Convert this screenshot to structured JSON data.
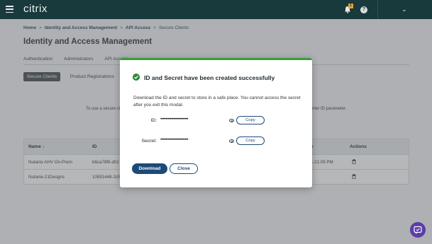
{
  "topbar": {
    "brand": "citrix",
    "notification_count": "1",
    "help_symbol": "?",
    "chevron": "⌄",
    "colors": {
      "background": "#193a3c",
      "badge": "#e8a13a"
    }
  },
  "breadcrumb": [
    "Home",
    "Identity and Access Management",
    "API Access",
    "Secure Clients"
  ],
  "breadcrumb_separator": ">",
  "page_title": "Identity and Access Management",
  "tabs": [
    "Authentication",
    "Administrators",
    "API Access"
  ],
  "subtabs": {
    "active": "Secure Clients",
    "other": "Product Registrations"
  },
  "info": {
    "left": "To use a secure cl",
    "right": "mer ID parameter."
  },
  "table": {
    "headers": {
      "name": "Name",
      "sort_arrow": "↓",
      "id": "ID",
      "date": "e",
      "actions": "Actions"
    },
    "rows": [
      {
        "name": "Nutanix AHV On-Prem",
        "id": "b6ca78f8-d02",
        "date": "1:21:09 PM",
        "action_icon": "trash-icon"
      },
      {
        "name": "Nutanix-21Desgns",
        "id": "10851448-2c5",
        "date": "",
        "action_icon": "trash-icon"
      }
    ]
  },
  "modal": {
    "title": "ID and Secret have been created successfully",
    "description": "Download the ID and secret to store in a safe place. You cannot access the secret after you exit this modal.",
    "id_label": "ID:",
    "id_value": "••••••••••••••••••••••••••",
    "secret_label": "Secret:",
    "secret_value": "••••••••••••••••••••••••••",
    "copy_label": "Copy",
    "download_label": "Download",
    "close_label": "Close",
    "colors": {
      "accent_bar": "#3c9b3a",
      "primary_button": "#1c4a78"
    }
  },
  "icons": [
    "menu-icon",
    "bell-icon",
    "help-icon",
    "check-circle-icon",
    "eye-icon",
    "trash-icon",
    "chat-icon"
  ]
}
